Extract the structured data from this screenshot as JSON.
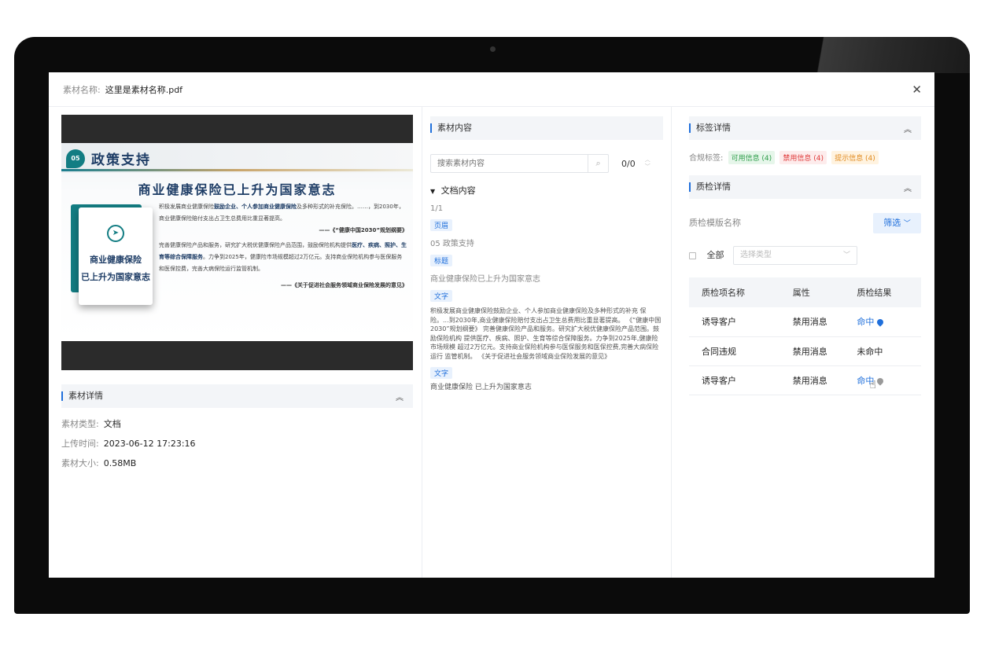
{
  "header": {
    "name_label": "素材名称:",
    "name_value": "这里是素材名称.pdf"
  },
  "preview": {
    "slide_number": "05",
    "slide_title": "政策支持",
    "slide_heading": "商业健康保险已上升为国家意志",
    "card_line1": "商业健康保险",
    "card_line2": "已上升为国家意志",
    "para1_a": "积极发展商业健康保险",
    "para1_b": "鼓励企业、个人参加商业健康保险",
    "para1_c": "及多种形式的补充保险。……，到2030年，商业健康保险赔付支出占卫生总费用比重显著提高。",
    "quote1": "——《“健康中国2030”规划纲要》",
    "para2_a": "完善健康保险产品和服务，研究扩大税优健康保险产品范围，鼓励保险机构提供",
    "para2_b": "医疗、疾病、照护、生育等综合保障服务",
    "para2_c": "。力争到2025年，健康险市场规模超过2万亿元。支持商业保险机构参与医保服务和医保控费，完善大病保险运行监管机制。",
    "quote2": "——《关于促进社会服务领域商业保险发展的意见》"
  },
  "details": {
    "section_title": "素材详情",
    "type_label": "素材类型:",
    "type_value": "文档",
    "time_label": "上传时间:",
    "time_value": "2023-06-12 17:23:16",
    "size_label": "素材大小:",
    "size_value": "0.58MB"
  },
  "content": {
    "section_title": "素材内容",
    "search_placeholder": "搜索素材内容",
    "count": "0/0",
    "doc_title": "文档内容",
    "page": "1/1",
    "tag_header": "页眉",
    "line_header": "05 政策支持",
    "tag_title": "标题",
    "line_title": "商业健康保险已上升为国家意志",
    "tag_text": "文字",
    "paragraph": "积极发展商业健康保险鼓励企业、个人参加商业健康保险及多种形式的补充 保险。...到2030年,商业健康保险赔付支出占卫生总费用比重显著提高。 《“健康中国2030”规划纲要》 完善健康保险产品和服务。研究扩大税优健康保险产品范围。鼓励保险机构 提供医疗、疾病、照护、生育等综合保障服务。力争到2025年,健康险市场规模 超过2万亿元。支持商业保险机构参与医保服务和医保控费,完善大病保险运行 监管机制。 《关于促进社会服务领域商业保险发展的意见》",
    "tag_text2": "文字",
    "line_last": "商业健康保险 已上升为国家意志"
  },
  "labels": {
    "section_title": "标签详情",
    "compliance_label": "合规标签:",
    "chips": [
      "可用信息 (4)",
      "禁用信息 (4)",
      "提示信息 (4)"
    ]
  },
  "quality": {
    "section_title": "质检详情",
    "template_label": "质检模版名称",
    "filter_button": "筛选",
    "all_label": "全部",
    "type_placeholder": "选择类型",
    "columns": [
      "质检项名称",
      "属性",
      "质检结果"
    ],
    "rows": [
      {
        "name": "诱导客户",
        "attr": "禁用消息",
        "result": "命中"
      },
      {
        "name": "合同违规",
        "attr": "禁用消息",
        "result": "未命中"
      },
      {
        "name": "诱导客户",
        "attr": "禁用消息",
        "result": "命中"
      }
    ]
  },
  "colors": {
    "accent": "#1f6fdb",
    "danger": "#e03c3c",
    "success": "#2f9e4b",
    "warning": "#e08a1e",
    "slide_teal": "#137d83"
  },
  "icons": [
    "close-icon",
    "search-icon",
    "collapse-icon",
    "location-pin-icon",
    "chevron-down-icon"
  ]
}
